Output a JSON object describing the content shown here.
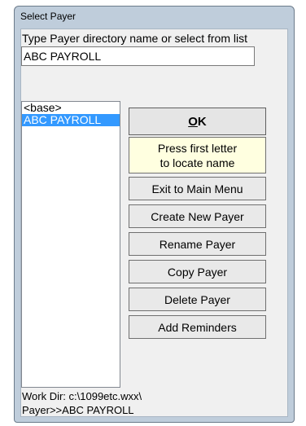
{
  "window": {
    "title": "Select Payer"
  },
  "prompt": {
    "label": "Type Payer directory name or select from list",
    "input_value": "ABC PAYROLL"
  },
  "payer_list": {
    "items": [
      {
        "label": "<base>",
        "selected": false
      },
      {
        "label": "ABC PAYROLL",
        "selected": true
      }
    ]
  },
  "buttons": {
    "ok_mnemonic": "O",
    "ok_rest": "K",
    "exit": "Exit to Main Menu",
    "create": "Create New Payer",
    "rename": "Rename Payer",
    "copy": "Copy Payer",
    "delete": "Delete Payer",
    "reminders": "Add Reminders"
  },
  "hint": {
    "line1": "Press first letter",
    "line2": "to locate name"
  },
  "footer": {
    "work_dir": "Work Dir: c:\\1099etc.wxx\\",
    "payer": "Payer>>ABC PAYROLL"
  },
  "colors": {
    "selection": "#3399ff",
    "hint_background": "#ffffe0"
  }
}
